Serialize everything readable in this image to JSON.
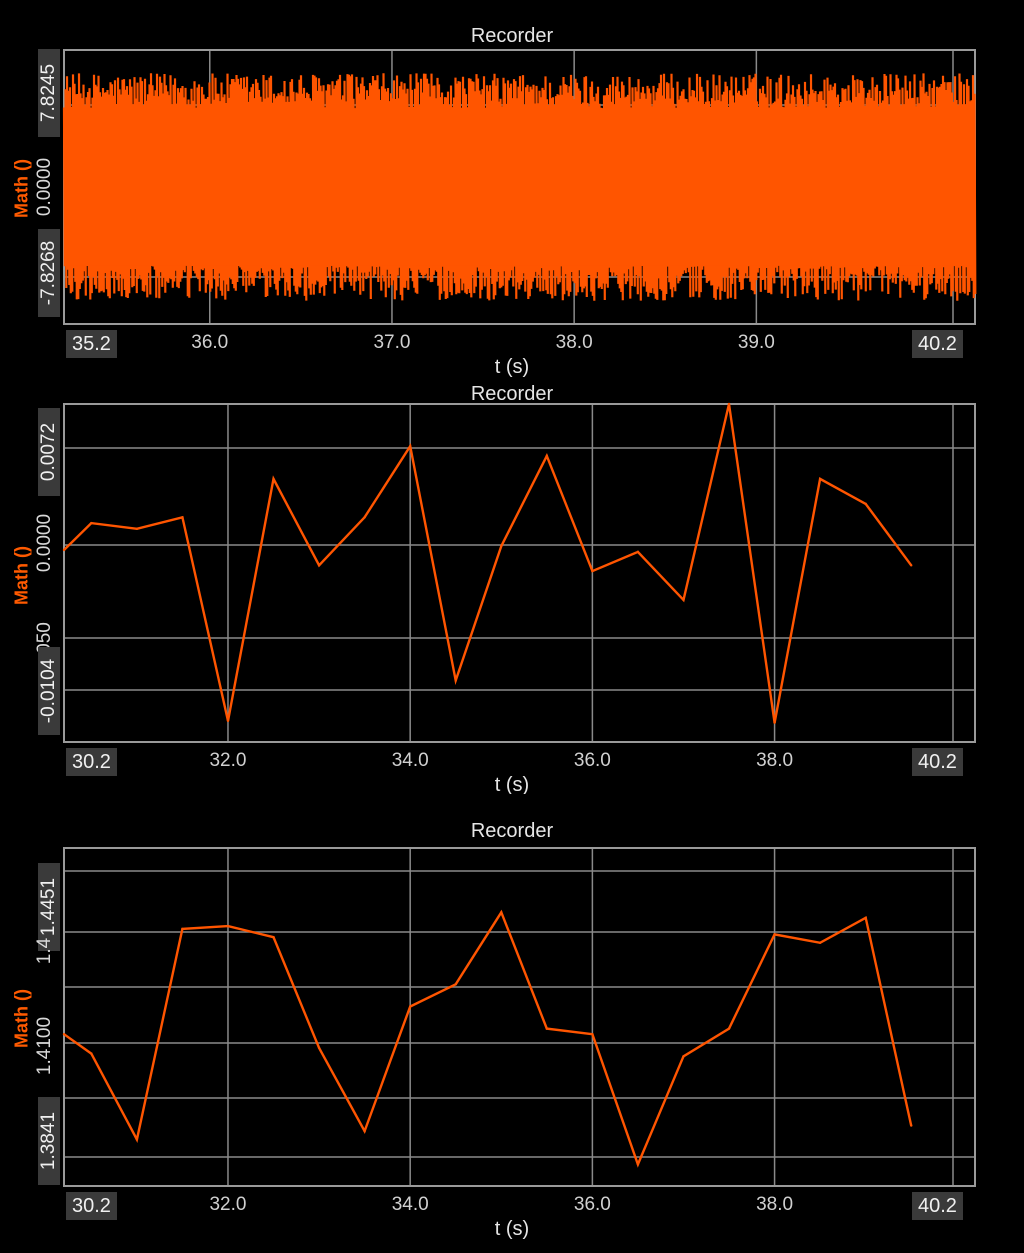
{
  "colors": {
    "background": "#000000",
    "series": "#ff5500",
    "grid": "#8a8a8a",
    "frame": "#9a9a9a",
    "text": "#e6e6e6",
    "boundBox": "#3a3a3a"
  },
  "chart_data": [
    {
      "type": "line",
      "title": "Recorder",
      "xlabel": "t (s)",
      "ylabel": "Math ()",
      "xlim": [
        35.2,
        40.2
      ],
      "ylim": [
        -7.8268,
        7.8245
      ],
      "x_bounds": [
        "35.2",
        "40.2"
      ],
      "x_ticks": [
        "36.0",
        "37.0",
        "38.0",
        "39.0"
      ],
      "y_ticks": [
        "7.8245",
        "0.0000",
        "-7.8268"
      ],
      "noise_band": {
        "center": 0.0,
        "approx_half_width": 4.5,
        "peak_amplitude": 6.5
      },
      "grid": true
    },
    {
      "type": "line",
      "title": "Recorder",
      "xlabel": "t (s)",
      "ylabel": "Math ()",
      "xlim": [
        30.2,
        40.2
      ],
      "ylim": [
        -0.0104,
        0.0072
      ],
      "x_bounds": [
        "30.2",
        "40.2"
      ],
      "x_ticks": [
        "32.0",
        "34.0",
        "36.0",
        "38.0"
      ],
      "y_ticks": [
        "0.0072",
        "0.0000",
        "-0.0104"
      ],
      "y_partial_tick": "050",
      "x": [
        30.2,
        30.5,
        31.0,
        31.5,
        32.0,
        32.5,
        33.0,
        33.5,
        34.0,
        34.5,
        35.0,
        35.5,
        36.0,
        36.5,
        37.0,
        37.5,
        38.0,
        38.5,
        39.0,
        39.5
      ],
      "y": [
        -0.0004,
        0.001,
        0.0007,
        0.0013,
        -0.0093,
        0.0033,
        -0.0012,
        0.0013,
        0.005,
        -0.0072,
        -0.0002,
        0.0045,
        -0.0015,
        -0.0005,
        -0.003,
        0.0072,
        -0.0094,
        0.0033,
        0.002,
        -0.0012
      ],
      "grid": true
    },
    {
      "type": "line",
      "title": "Recorder",
      "xlabel": "t (s)",
      "ylabel": "Math ()",
      "xlim": [
        30.2,
        40.2
      ],
      "ylim": [
        1.3841,
        1.4451
      ],
      "x_bounds": [
        "30.2",
        "40.2"
      ],
      "x_ticks": [
        "32.0",
        "34.0",
        "36.0",
        "38.0"
      ],
      "y_ticks": [
        "1.4451",
        "1.4100",
        "1.3841"
      ],
      "y_partial_ticks": [
        "1.4"
      ],
      "x": [
        30.2,
        30.5,
        31.0,
        31.5,
        32.0,
        32.5,
        33.0,
        33.5,
        34.0,
        34.5,
        35.0,
        35.5,
        36.0,
        36.5,
        37.0,
        37.5,
        38.0,
        38.5,
        39.0,
        39.5
      ],
      "y": [
        1.4115,
        1.408,
        1.3925,
        1.4305,
        1.431,
        1.429,
        1.409,
        1.394,
        1.4165,
        1.4205,
        1.4335,
        1.4125,
        1.4115,
        1.388,
        1.4075,
        1.4125,
        1.4295,
        1.428,
        1.4325,
        1.395
      ],
      "grid": true
    }
  ]
}
